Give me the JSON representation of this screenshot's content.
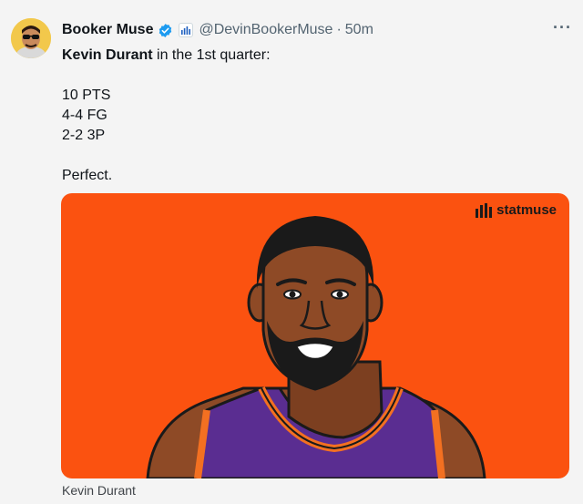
{
  "tweet": {
    "display_name": "Booker Muse",
    "handle": "@DevinBookerMuse",
    "separator": "·",
    "time": "50m",
    "more_label": "···",
    "mention": "Kevin Durant",
    "intro_rest": " in the 1st quarter:",
    "stats": [
      "10 PTS",
      "4-4 FG",
      "2-2 3P"
    ],
    "closing": "Perfect."
  },
  "card": {
    "brand": "statmuse",
    "caption": "Kevin Durant",
    "background": "#fb5210",
    "jersey_color": "#5a2d91",
    "trim_color": "#f37021"
  },
  "icons": {
    "verified": "verified-badge-icon",
    "affiliate": "affiliate-badge-icon",
    "more": "more-options-icon"
  }
}
